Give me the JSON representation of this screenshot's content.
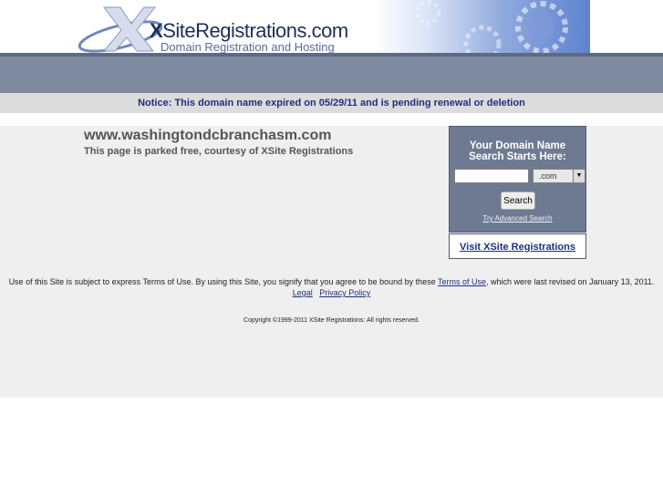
{
  "header": {
    "logo": {
      "brand_mark": "X",
      "brand_rest": "SiteRegistrations.com",
      "tagline": "Domain Registration and Hosting"
    }
  },
  "notice": {
    "text": "Notice: This domain name expired on 05/29/11 and is pending renewal or deletion"
  },
  "main": {
    "domain": "www.washingtondcbranchasm.com",
    "parked_text": "This page is parked free, courtesy of XSite Registrations"
  },
  "search": {
    "heading_line1": "Your Domain Name",
    "heading_line2": "Search Starts Here:",
    "input_value": "",
    "tld_selected": ".com",
    "button_label": "Search",
    "advanced_link": "Try Advanced Search",
    "visit_link": "Visit XSite Registrations"
  },
  "footer": {
    "terms_before": "Use of this Site is subject to express Terms of Use. By using this Site, you signify that you agree to be bound by these ",
    "terms_link": "Terms of Use",
    "terms_after": ", which were last revised on January 13, 2011.",
    "legal_link": "Legal",
    "privacy_link": "Privacy Policy",
    "copyright": "Copyright ©1999-2011 XSite Registrations: All rights reserved."
  },
  "colors": {
    "nav_bar": "#7d8aa0",
    "search_panel": "#6e7a92",
    "link_blue": "#1f2f7a"
  }
}
